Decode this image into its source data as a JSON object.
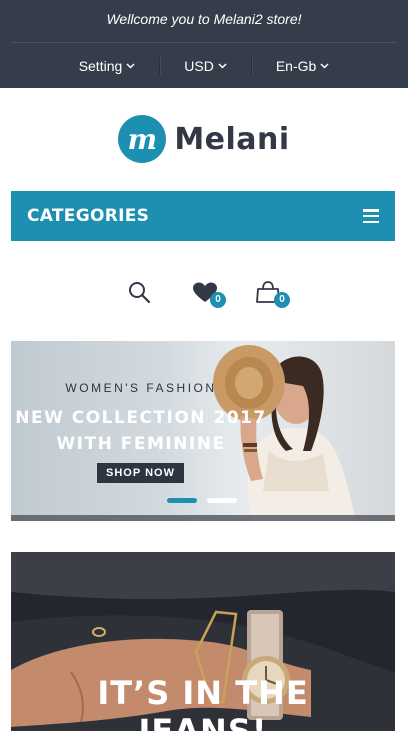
{
  "topbar": {
    "welcome": "Wellcome you to Melani2 store!",
    "menu": [
      {
        "label": "Setting"
      },
      {
        "label": "USD"
      },
      {
        "label": "En-Gb"
      }
    ]
  },
  "logo": {
    "mark": "m",
    "text": "Melani"
  },
  "categories": {
    "label": "CATEGORIES",
    "icon": "hamburger-menu-icon"
  },
  "icons": {
    "search": "search-icon",
    "wishlist": {
      "icon": "heart-icon",
      "count": "0"
    },
    "cart": {
      "icon": "shopping-bag-icon",
      "count": "0"
    }
  },
  "banner1": {
    "subtitle": "WOMEN'S FASHION",
    "title_line1": "NEW COLLECTION 2017",
    "title_line2": "WITH FEMININE",
    "button": "SHOP NOW",
    "slides_total": 2,
    "active_slide": 1
  },
  "banner2": {
    "line1": "IT’S IN THE",
    "line2": "JEANS!"
  },
  "colors": {
    "accent": "#1d8fb0",
    "topbar": "#363d4a",
    "dark": "#333846"
  }
}
